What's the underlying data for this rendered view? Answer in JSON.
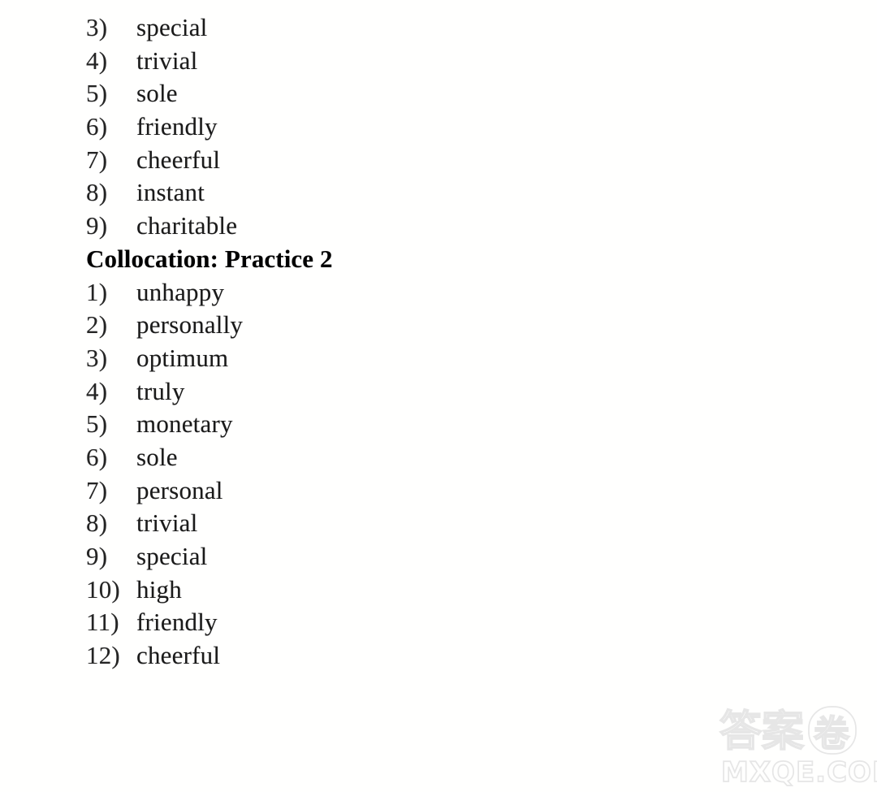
{
  "page": {
    "background_color": "#ffffff",
    "text_color": "#1a1a1a",
    "watermark_color": "#e6e6e6"
  },
  "answer_key": {
    "blocks": [
      {
        "type": "list",
        "items": [
          {
            "num": "3)",
            "word": "special"
          },
          {
            "num": "4)",
            "word": "trivial"
          },
          {
            "num": "5)",
            "word": "sole"
          },
          {
            "num": "6)",
            "word": "friendly"
          },
          {
            "num": "7)",
            "word": "cheerful"
          },
          {
            "num": "8)",
            "word": "instant"
          },
          {
            "num": "9)",
            "word": "charitable"
          }
        ]
      },
      {
        "type": "heading",
        "text": "Collocation: Practice 2"
      },
      {
        "type": "list",
        "items": [
          {
            "num": "1)",
            "word": "unhappy"
          },
          {
            "num": "2)",
            "word": "personally"
          },
          {
            "num": "3)",
            "word": "optimum"
          },
          {
            "num": "4)",
            "word": "truly"
          },
          {
            "num": "5)",
            "word": "monetary"
          },
          {
            "num": "6)",
            "word": "sole"
          },
          {
            "num": "7)",
            "word": "personal"
          },
          {
            "num": "8)",
            "word": "trivial"
          },
          {
            "num": "9)",
            "word": "special"
          },
          {
            "num": "10)",
            "word": "high"
          },
          {
            "num": "11)",
            "word": "friendly"
          },
          {
            "num": "12)",
            "word": "cheerful"
          }
        ]
      }
    ]
  },
  "watermark": {
    "cjk_text": "答案",
    "circled_char": "卷",
    "site_text": "MXQE.COM"
  }
}
